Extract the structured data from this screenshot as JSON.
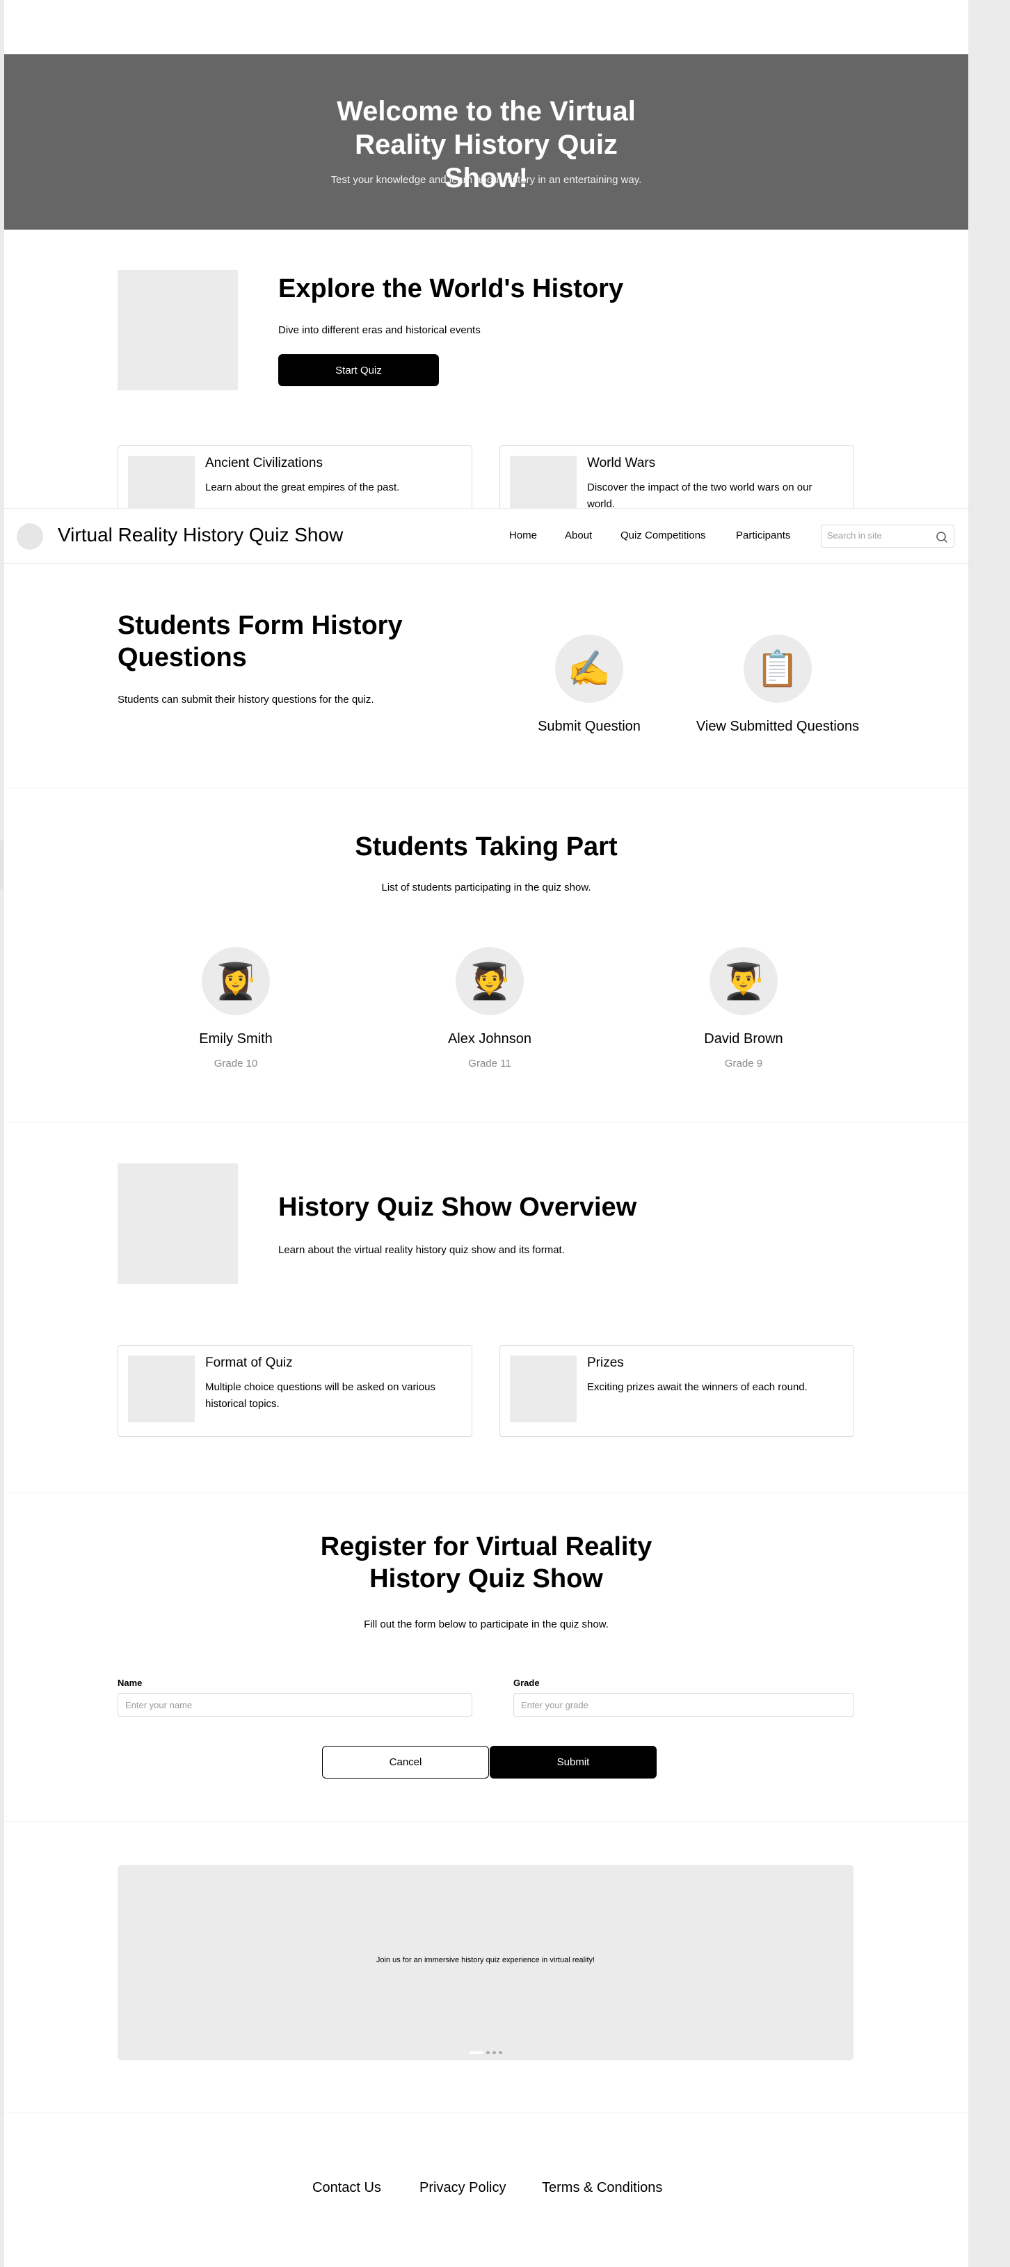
{
  "hero": {
    "title": "Welcome to the Virtual Reality History Quiz Show!",
    "subtitle": "Test your knowledge and learn about history in an entertaining way."
  },
  "explore": {
    "title": "Explore the World's History",
    "subtitle": "Dive into different eras and historical events",
    "button": "Start Quiz",
    "cards": [
      {
        "title": "Ancient Civilizations",
        "desc": "Learn about the great empires of the past."
      },
      {
        "title": "World Wars",
        "desc": "Discover the impact of the two world wars on our world."
      }
    ]
  },
  "navbar": {
    "site_title": "Virtual Reality History Quiz Show",
    "links": [
      "Home",
      "About",
      "Quiz Competitions",
      "Participants"
    ],
    "search_placeholder": "Search in site"
  },
  "form_section": {
    "title": "Students Form History Questions",
    "subtitle": "Students can submit their history questions for the quiz.",
    "actions": [
      {
        "label": "Submit Question",
        "icon": "✍️"
      },
      {
        "label": "View Submitted Questions",
        "icon": "📋"
      }
    ]
  },
  "participants": {
    "title": "Students Taking Part",
    "subtitle": "List of students participating in the quiz show.",
    "students": [
      {
        "name": "Emily Smith",
        "grade": "Grade 10",
        "icon": "👩‍🎓"
      },
      {
        "name": "Alex Johnson",
        "grade": "Grade 11",
        "icon": "🧑‍🎓"
      },
      {
        "name": "David Brown",
        "grade": "Grade 9",
        "icon": "👨‍🎓"
      }
    ]
  },
  "overview": {
    "title": "History Quiz Show Overview",
    "subtitle": "Learn about the virtual reality history quiz show and its format.",
    "cards": [
      {
        "title": "Format of Quiz",
        "desc": "Multiple choice questions will be asked on various historical topics."
      },
      {
        "title": "Prizes",
        "desc": "Exciting prizes await the winners of each round."
      }
    ]
  },
  "register": {
    "title": "Register for Virtual Reality History Quiz Show",
    "subtitle": "Fill out the form below to participate in the quiz show.",
    "name_label": "Name",
    "name_placeholder": "Enter your name",
    "grade_label": "Grade",
    "grade_placeholder": "Enter your grade",
    "cancel": "Cancel",
    "submit": "Submit"
  },
  "banner": {
    "text": "Join us for an immersive history quiz experience in virtual reality!",
    "slide_count": 4,
    "active_slide": 1
  },
  "footer": {
    "links": [
      "Contact Us",
      "Privacy Policy",
      "Terms & Conditions"
    ]
  },
  "colors": {
    "hero_bg": "#666666",
    "primary_button": "#000000",
    "placeholder": "#ebebeb"
  }
}
